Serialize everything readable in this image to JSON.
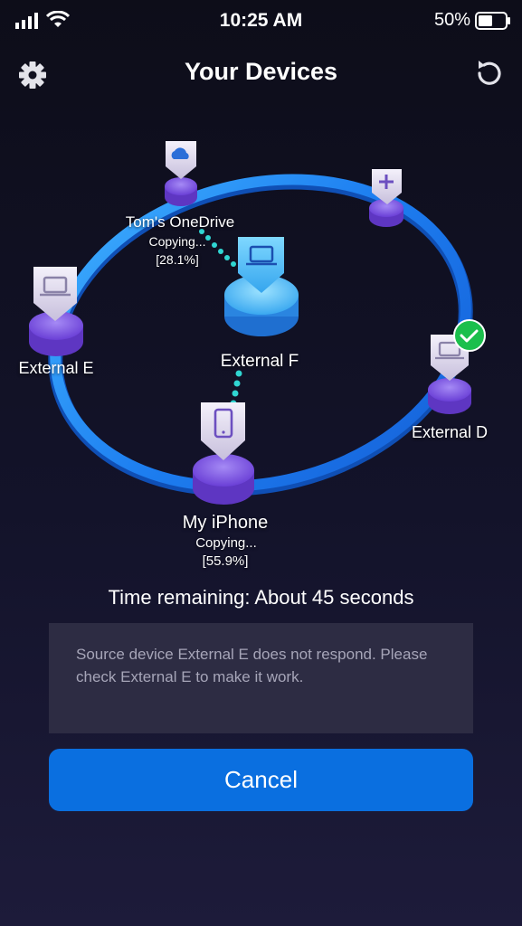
{
  "status_bar": {
    "time": "10:25 AM",
    "battery": "50%",
    "icons": [
      "signal-icon",
      "wifi-icon",
      "battery-icon"
    ]
  },
  "header": {
    "title": "Your Devices",
    "settings_icon": "gear-icon",
    "refresh_icon": "refresh-icon"
  },
  "devices": {
    "onedrive": {
      "name": "Tom's OneDrive",
      "status": "Copying...",
      "progress": "[28.1%]",
      "progress_value": 28.1,
      "icon": "cloud-icon"
    },
    "add": {
      "icon": "plus-icon"
    },
    "external_e": {
      "name": "External E",
      "icon": "laptop-icon"
    },
    "external_f": {
      "name": "External F",
      "icon": "laptop-icon"
    },
    "external_d": {
      "name": "External D",
      "icon": "laptop-icon",
      "badge_icon": "checkmark-icon"
    },
    "iphone": {
      "name": "My iPhone",
      "status": "Copying...",
      "progress": "[55.9%]",
      "progress_value": 55.9,
      "icon": "phone-icon"
    }
  },
  "time_remaining": "Time remaining: About 45 seconds",
  "message": "Source device External E does not respond. Please check External E to make it work.",
  "cancel_label": "Cancel",
  "colors": {
    "ring": "#1e8ef0",
    "node_purple": "#7b4fe0",
    "node_blue": "#2fa3ee",
    "dots": "#30d6d2",
    "check": "#1bbf4c",
    "button": "#0a6fe0"
  }
}
